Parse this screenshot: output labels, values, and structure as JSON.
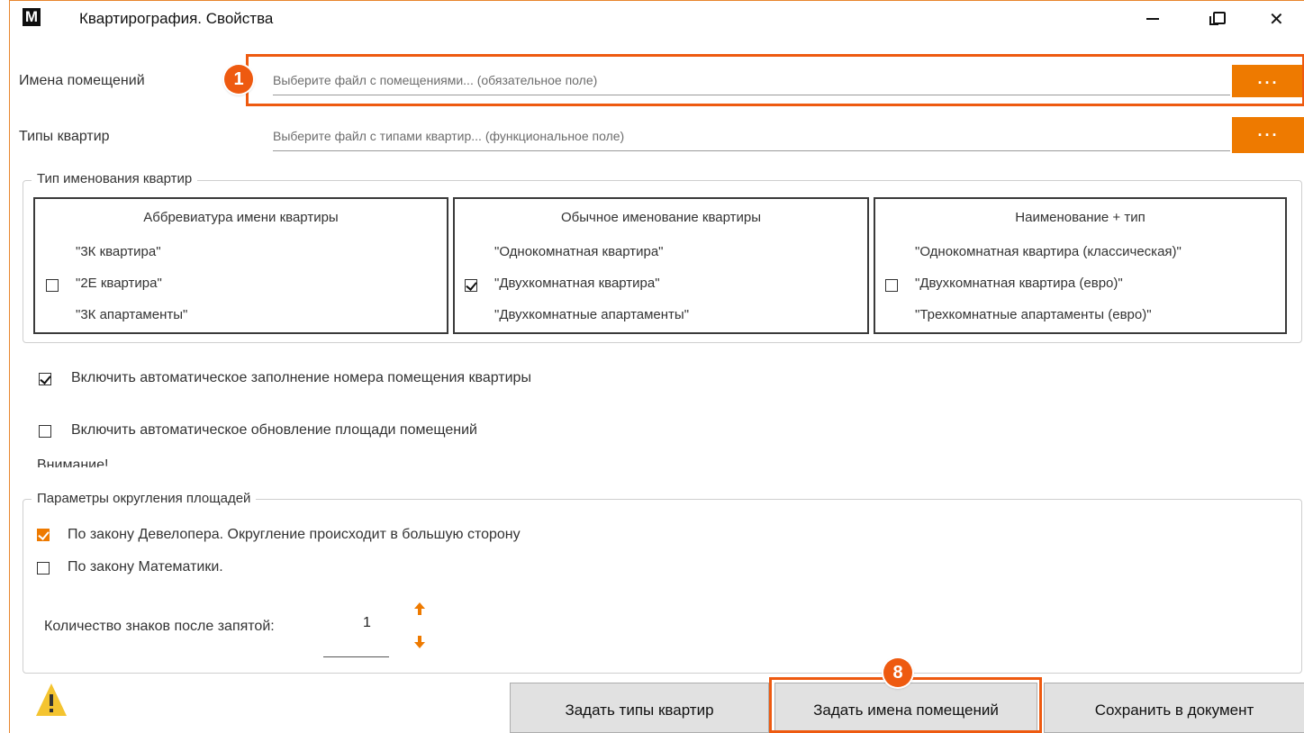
{
  "window": {
    "logo_letter": "M",
    "title": "Квартирография. Свойства",
    "accent_color": "#ee7a00",
    "highlight_color": "#ee5a10"
  },
  "files": {
    "rooms_label": "Имена помещений",
    "rooms_placeholder": "Выберите файл с помещениями... (обязательное поле)",
    "types_label": "Типы квартир",
    "types_placeholder": "Выберите файл с типами квартир... (функциональное поле)",
    "browse_label": "..."
  },
  "naming": {
    "legend": "Тип именования квартир",
    "options": [
      {
        "header": "Аббревиатура имени квартиры",
        "examples": [
          "\"3К квартира\"",
          "\"2Е квартира\"",
          "\"3К апартаменты\""
        ],
        "checked": false
      },
      {
        "header": "Обычное именование квартиры",
        "examples": [
          "\"Однокомнатная квартира\"",
          "\"Двухкомнатная квартира\"",
          "\"Двухкомнатные апартаменты\""
        ],
        "checked": true
      },
      {
        "header": "Наименование + тип",
        "examples": [
          "\"Однокомнатная квартира (классическая)\"",
          "\"Двухкомнатная квартира (евро)\"",
          "\"Трехкомнатные апартаменты (евро)\""
        ],
        "checked": false
      }
    ]
  },
  "options": {
    "auto_number_label": "Включить автоматическое заполнение номера помещения квартиры",
    "auto_number_checked": true,
    "auto_area_label": "Включить автоматическое обновление площади помещений",
    "auto_area_checked": false,
    "warning_text": "Внимание!"
  },
  "rounding": {
    "legend": "Параметры округления площадей",
    "developer_label": "По закону Девелопера. Округление происходит в большую сторону",
    "developer_checked": true,
    "math_label": "По закону Математики.",
    "math_checked": false,
    "decimals_label": "Количество знаков после запятой:",
    "decimals_value": "1"
  },
  "buttons": {
    "set_types": "Задать типы квартир",
    "set_names": "Задать имена помещений",
    "save": "Сохранить в документ"
  },
  "annotations": {
    "badge_1": "1",
    "badge_8": "8"
  },
  "icons": {
    "warning": "warning-icon",
    "up": "arrow-up-icon",
    "down": "arrow-down-icon"
  }
}
